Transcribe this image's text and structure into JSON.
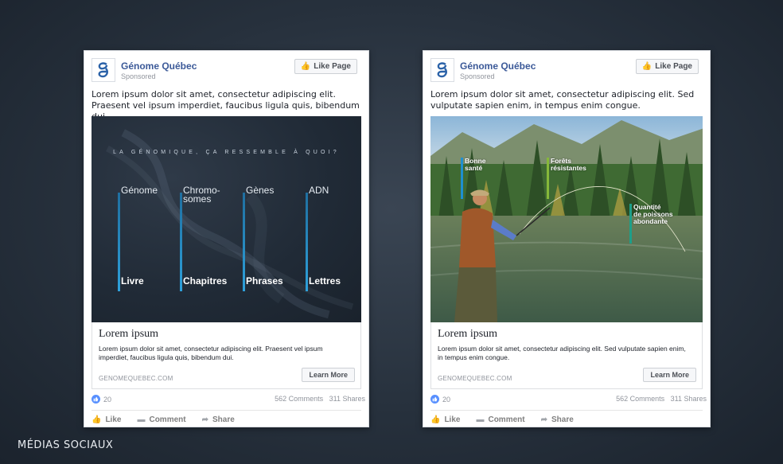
{
  "footer_label": "MÉDIAS SOCIAUX",
  "colors": {
    "brand_blue": "#3b5998",
    "accent_bar": "#2ea1db",
    "annot_green": "#1e9f8a",
    "annot_lime": "#86b83a"
  },
  "ads": [
    {
      "page_name": "Génome Québec",
      "sponsored": "Sponsored",
      "like_page_label": "Like Page",
      "post_text": "Lorem ipsum dolor sit amet, consectetur adipiscing elit. Praesent vel ipsum imperdiet, faucibus ligula quis, bibendum dui.",
      "media": {
        "headline": "LA GÉNOMIQUE, ÇA RESSEMBLE À QUOI?",
        "columns": [
          {
            "top": "Génome",
            "bottom": "Livre"
          },
          {
            "top": "Chromo-\nsomes",
            "bottom": "Chapitres"
          },
          {
            "top": "Gènes",
            "bottom": "Phrases"
          },
          {
            "top": "ADN",
            "bottom": "Lettres"
          }
        ]
      },
      "link_title": "Lorem ipsum",
      "link_description": "Lorem ipsum dolor sit amet, consectetur adipiscing elit. Praesent vel ipsum imperdiet, faucibus ligula quis, bibendum dui.",
      "link_domain": "GENOMEQUEBEC.COM",
      "cta_label": "Learn More",
      "reactions": "20",
      "comments_shares": "562 Comments   311 Shares",
      "actions": [
        "Like",
        "Comment",
        "Share"
      ]
    },
    {
      "page_name": "Génome Québec",
      "sponsored": "Sponsored",
      "like_page_label": "Like Page",
      "post_text": "Lorem ipsum dolor sit amet, consectetur adipiscing elit. Sed vulputate sapien enim, in tempus enim congue.",
      "media": {
        "annotations": [
          {
            "label": "Bonne\nsanté",
            "color": "#1e8fd0"
          },
          {
            "label": "Forêts\nrésistantes",
            "color": "#86b83a"
          },
          {
            "label": "Quantité\nde poissons\nabondante",
            "color": "#1e9f8a"
          }
        ]
      },
      "link_title": "Lorem ipsum",
      "link_description": "Lorem ipsum dolor sit amet, consectetur adipiscing elit. Sed vulputate sapien enim, in tempus enim congue.",
      "link_domain": "GENOMEQUEBEC.COM",
      "cta_label": "Learn More",
      "reactions": "20",
      "comments_shares": "562 Comments   311 Shares",
      "actions": [
        "Like",
        "Comment",
        "Share"
      ]
    }
  ]
}
